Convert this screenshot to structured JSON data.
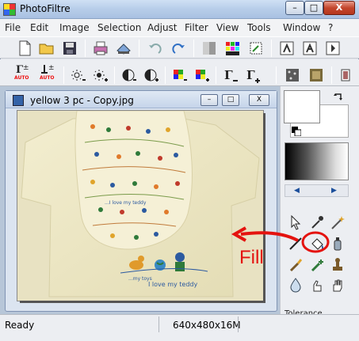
{
  "window": {
    "title": "PhotoFiltre",
    "min_label": "–",
    "max_label": "□",
    "close_label": "X"
  },
  "menu": [
    "File",
    "Edit",
    "Image",
    "Selection",
    "Adjust",
    "Filter",
    "View",
    "Tools",
    "Window",
    "?"
  ],
  "toolbar_row1_icons": [
    "new-icon",
    "open-icon",
    "save-icon",
    "print-icon",
    "scan-icon",
    "undo-icon",
    "redo-icon",
    "grayscale-icon",
    "palette-icon",
    "crop-icon",
    "resize-image-icon",
    "resize-canvas-icon",
    "slideshow-icon"
  ],
  "toolbar_row2": {
    "auto_levels_label": "AUTO",
    "auto_contrast_label": "AUTO",
    "icons": [
      "auto-levels-icon",
      "auto-contrast-icon",
      "brightness-minus-icon",
      "brightness-plus-icon",
      "contrast-minus-icon",
      "contrast-plus-icon",
      "saturation-minus-icon",
      "saturation-plus-icon",
      "gamma-minus-icon",
      "gamma-plus-icon",
      "dust-filter-icon",
      "soften-filter-icon",
      "more-icon"
    ]
  },
  "document": {
    "title": "yellow 3 pc - Copy.jpg",
    "min_label": "–",
    "max_label": "□",
    "close_label": "X",
    "image_text": [
      "...I love my teddy",
      "...my toys",
      "I love my teddy"
    ]
  },
  "tools_panel": {
    "tools": [
      "pointer-tool-icon",
      "eyedropper-tool-icon",
      "magic-wand-tool-icon",
      "line-tool-icon",
      "fill-bucket-tool-icon",
      "spray-tool-icon",
      "brush-tool-icon",
      "advanced-brush-tool-icon",
      "stamp-tool-icon",
      "blur-tool-icon",
      "finger-tool-icon",
      "hand-tool-icon"
    ],
    "tolerance_label": "Tolerance"
  },
  "annotation": {
    "label": "Fill",
    "color": "#e4130f"
  },
  "statusbar": {
    "status": "Ready",
    "dimensions": "640x480x16M"
  },
  "colors": {
    "title_bar": "#b7cde9",
    "workspace": "#b7c6d8",
    "shirt": "#ece7c6",
    "annotation": "#e4130f"
  }
}
